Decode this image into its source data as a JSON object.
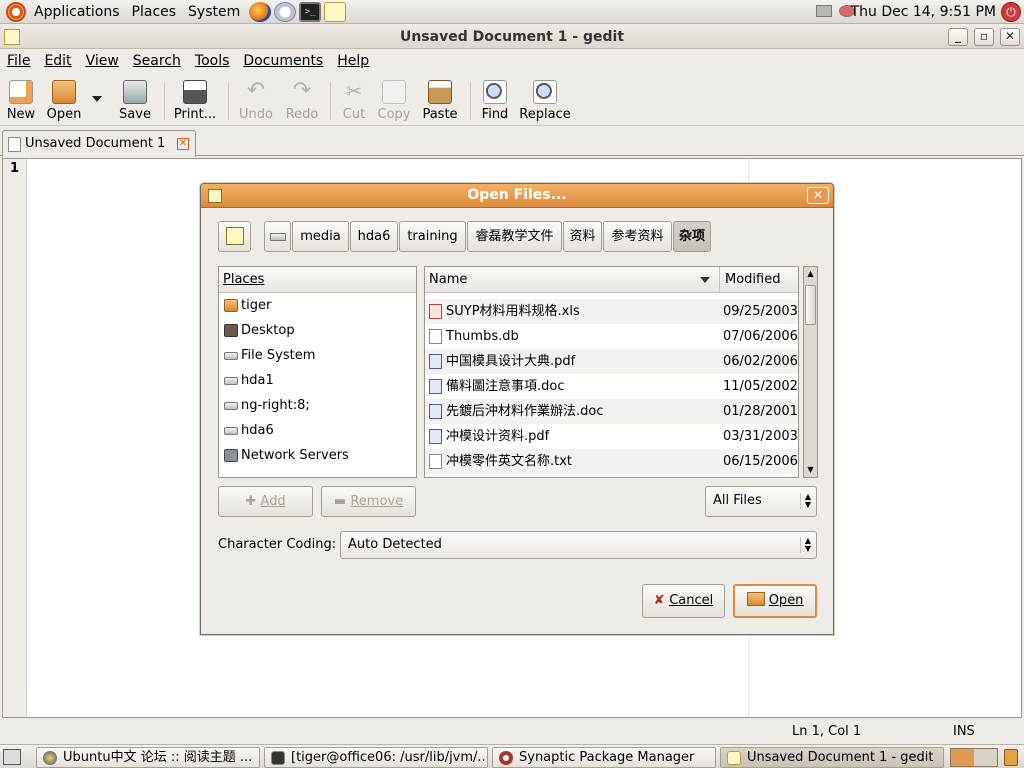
{
  "top_panel": {
    "menus": [
      "Applications",
      "Places",
      "System"
    ],
    "clock": "Thu Dec 14,  9:51 PM"
  },
  "window": {
    "title": "Unsaved Document 1 - gedit",
    "controls": [
      "_",
      "▫",
      "✕"
    ]
  },
  "menubar": [
    "File",
    "Edit",
    "View",
    "Search",
    "Tools",
    "Documents",
    "Help"
  ],
  "toolbar": {
    "new": "New",
    "open": "Open",
    "save": "Save",
    "print": "Print...",
    "undo": "Undo",
    "redo": "Redo",
    "cut": "Cut",
    "copy": "Copy",
    "paste": "Paste",
    "find": "Find",
    "replace": "Replace"
  },
  "tab": {
    "label": "Unsaved Document 1"
  },
  "editor": {
    "line_number": "1"
  },
  "statusbar": {
    "position": "Ln 1, Col 1",
    "mode": "INS"
  },
  "dialog": {
    "title": "Open Files...",
    "breadcrumbs": [
      "media",
      "hda6",
      "training",
      "睿磊教学文件",
      "资料",
      "参考资料",
      "杂项"
    ],
    "places_header": "Places",
    "places": [
      "tiger",
      "Desktop",
      "File System",
      "hda1",
      "ng-right:8;",
      "hda6",
      "Network Servers"
    ],
    "files_header": {
      "name": "Name",
      "modified": "Modified"
    },
    "files": [
      {
        "name": "SUYP材料用料规格.xls",
        "modified": "09/25/2003"
      },
      {
        "name": "Thumbs.db",
        "modified": "07/06/2006"
      },
      {
        "name": "中国模具设计大典.pdf",
        "modified": "06/02/2006"
      },
      {
        "name": "備料圖注意事項.doc",
        "modified": "11/05/2002"
      },
      {
        "name": "先鍍后沖材料作業辦法.doc",
        "modified": "01/28/2001"
      },
      {
        "name": "冲模设计资料.pdf",
        "modified": "03/31/2003"
      },
      {
        "name": "冲模零件英文名称.txt",
        "modified": "06/15/2006"
      }
    ],
    "add_label": "Add",
    "remove_label": "Remove",
    "filter": "All Files",
    "coding_label": "Character Coding:",
    "coding_value": "Auto Detected",
    "cancel_label": "Cancel",
    "open_label": "Open"
  },
  "taskbar": [
    "Ubuntu中文 论坛 :: 阅读主题 ...",
    "[tiger@office06: /usr/lib/jvm/...",
    "Synaptic Package Manager",
    "Unsaved Document 1 - gedit"
  ],
  "colors": {
    "accent": "#dd8a3c",
    "title_active": "#f2b266",
    "panel": "#dcd7d1"
  }
}
